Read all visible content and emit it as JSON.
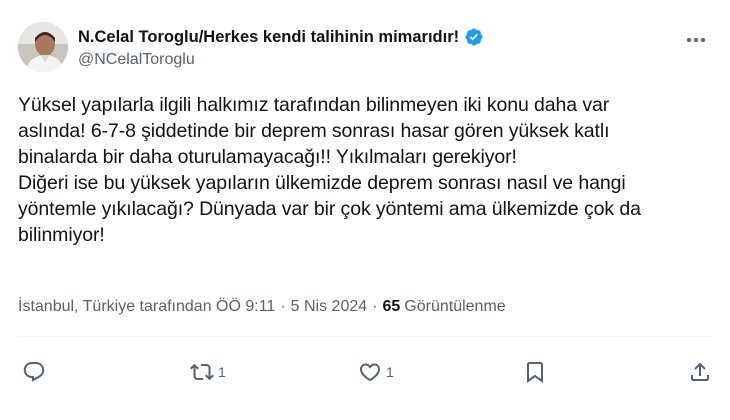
{
  "author": {
    "display_name": "N.Celal Toroglu/Herkes kendi talihinin mimarıdır!",
    "handle": "@NCelalToroglu",
    "verified_color": "#1d9bf0"
  },
  "tweet": {
    "text": "Yüksel yapılarla ilgili halkımız tarafından bilinmeyen iki konu daha var\naslında! 6-7-8 şiddetinde bir deprem sonrası hasar gören yüksek katlı\nbinalarda bir daha oturulamayacağı!! Yıkılmaları gerekiyor!\nDiğeri ise bu yüksek yapıların ülkemizde deprem sonrası nasıl ve hangi\nyöntemle yıkılacağı? Dünyada var bir çok yöntemi ama ülkemizde çok da\nbilinmiyor!"
  },
  "meta": {
    "location_time": "İstanbul, Türkiye tarafından ÖÖ 9:11",
    "separator": "·",
    "date": "5 Nis 2024",
    "views_count": "65",
    "views_label": "Görüntülenme"
  },
  "actions": {
    "reply_count": "",
    "retweet_count": "1",
    "like_count": "1"
  },
  "icons": {
    "more": "more-dots-icon",
    "verified": "verified-badge-icon",
    "reply": "reply-icon",
    "retweet": "retweet-icon",
    "like": "heart-icon",
    "bookmark": "bookmark-icon",
    "share": "share-icon"
  }
}
